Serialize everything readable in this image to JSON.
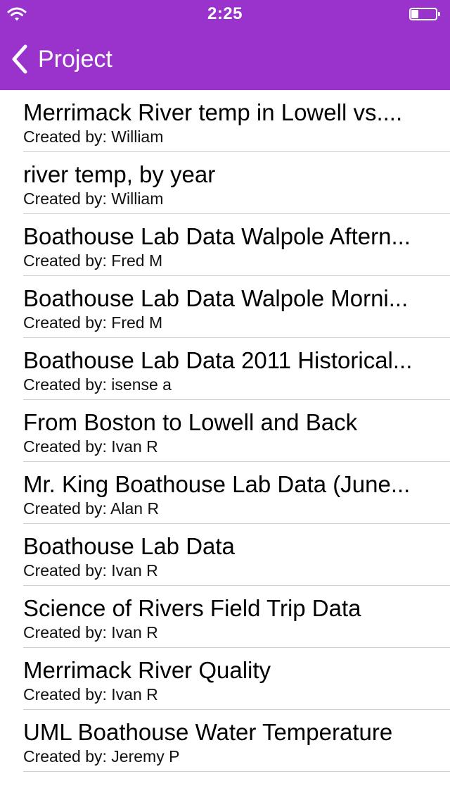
{
  "status_bar": {
    "time": "2:25",
    "battery_level": 0.3,
    "icons": [
      "wifi-icon",
      "battery-icon"
    ]
  },
  "nav": {
    "back_label": "Project",
    "back_icon": "chevron-left-icon",
    "bar_color": "#9933cc"
  },
  "projects": [
    {
      "title": "Merrimack River temp in Lowell vs....",
      "subtitle": "Created by: William"
    },
    {
      "title": "river temp, by year",
      "subtitle": "Created by: William"
    },
    {
      "title": "Boathouse Lab Data Walpole Aftern...",
      "subtitle": "Created by: Fred M"
    },
    {
      "title": "Boathouse Lab Data Walpole Morni...",
      "subtitle": "Created by: Fred M"
    },
    {
      "title": "Boathouse Lab Data 2011 Historical...",
      "subtitle": "Created by: isense a"
    },
    {
      "title": "From Boston to Lowell and Back",
      "subtitle": "Created by: Ivan R"
    },
    {
      "title": "Mr. King Boathouse Lab Data (June...",
      "subtitle": "Created by: Alan R"
    },
    {
      "title": "Boathouse Lab Data",
      "subtitle": "Created by: Ivan R"
    },
    {
      "title": "Science of Rivers Field Trip Data",
      "subtitle": "Created by: Ivan R"
    },
    {
      "title": "Merrimack River Quality",
      "subtitle": "Created by: Ivan R"
    },
    {
      "title": "UML Boathouse Water Temperature",
      "subtitle": "Created by: Jeremy P"
    }
  ]
}
